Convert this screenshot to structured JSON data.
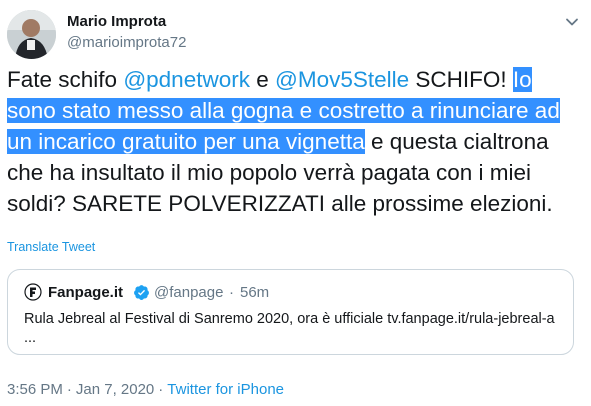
{
  "author": {
    "name": "Mario Improta",
    "handle": "@marioimprota72"
  },
  "tweet": {
    "part1": "Fate schifo ",
    "mention1": "@pdnetwork",
    "part2": " e ",
    "mention2": "@Mov5Stelle",
    "part3": " SCHIFO! ",
    "highlighted": "Io sono stato messo alla gogna e costretto a rinunciare ad un incarico gratuito per una vignetta",
    "part4": " e questa cialtrona che ha insultato il mio popolo verrà pagata con i miei soldi? SARETE POLVERIZZATI alle prossime elezioni."
  },
  "translate_label": "Translate Tweet",
  "quoted": {
    "name": "Fanpage.it",
    "handle": "@fanpage",
    "separator": "·",
    "time": "56m",
    "text": "Rula Jebreal al Festival di Sanremo 2020, ora è ufficiale tv.fanpage.it/rula-jebreal-a ..."
  },
  "meta": {
    "time": "3:56 PM",
    "separator": "·",
    "date": "Jan 7, 2020",
    "source": "Twitter for iPhone"
  },
  "colors": {
    "link": "#1b95e0",
    "selection": "#3390ff",
    "secondary_text": "#657786",
    "border": "#ccd6dd"
  },
  "icons": {
    "caret": "chevron-down-icon",
    "verified": "verified-badge-icon"
  }
}
